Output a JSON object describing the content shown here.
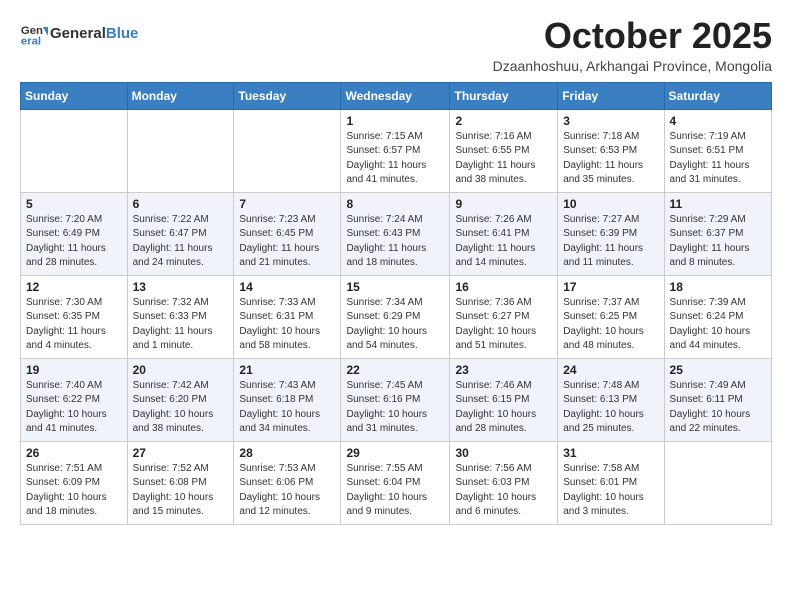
{
  "header": {
    "logo_general": "General",
    "logo_blue": "Blue",
    "title": "October 2025",
    "subtitle": "Dzaanhoshuu, Arkhangai Province, Mongolia"
  },
  "weekdays": [
    "Sunday",
    "Monday",
    "Tuesday",
    "Wednesday",
    "Thursday",
    "Friday",
    "Saturday"
  ],
  "weeks": [
    [
      {
        "day": "",
        "info": ""
      },
      {
        "day": "",
        "info": ""
      },
      {
        "day": "",
        "info": ""
      },
      {
        "day": "1",
        "info": "Sunrise: 7:15 AM\nSunset: 6:57 PM\nDaylight: 11 hours and 41 minutes."
      },
      {
        "day": "2",
        "info": "Sunrise: 7:16 AM\nSunset: 6:55 PM\nDaylight: 11 hours and 38 minutes."
      },
      {
        "day": "3",
        "info": "Sunrise: 7:18 AM\nSunset: 6:53 PM\nDaylight: 11 hours and 35 minutes."
      },
      {
        "day": "4",
        "info": "Sunrise: 7:19 AM\nSunset: 6:51 PM\nDaylight: 11 hours and 31 minutes."
      }
    ],
    [
      {
        "day": "5",
        "info": "Sunrise: 7:20 AM\nSunset: 6:49 PM\nDaylight: 11 hours and 28 minutes."
      },
      {
        "day": "6",
        "info": "Sunrise: 7:22 AM\nSunset: 6:47 PM\nDaylight: 11 hours and 24 minutes."
      },
      {
        "day": "7",
        "info": "Sunrise: 7:23 AM\nSunset: 6:45 PM\nDaylight: 11 hours and 21 minutes."
      },
      {
        "day": "8",
        "info": "Sunrise: 7:24 AM\nSunset: 6:43 PM\nDaylight: 11 hours and 18 minutes."
      },
      {
        "day": "9",
        "info": "Sunrise: 7:26 AM\nSunset: 6:41 PM\nDaylight: 11 hours and 14 minutes."
      },
      {
        "day": "10",
        "info": "Sunrise: 7:27 AM\nSunset: 6:39 PM\nDaylight: 11 hours and 11 minutes."
      },
      {
        "day": "11",
        "info": "Sunrise: 7:29 AM\nSunset: 6:37 PM\nDaylight: 11 hours and 8 minutes."
      }
    ],
    [
      {
        "day": "12",
        "info": "Sunrise: 7:30 AM\nSunset: 6:35 PM\nDaylight: 11 hours and 4 minutes."
      },
      {
        "day": "13",
        "info": "Sunrise: 7:32 AM\nSunset: 6:33 PM\nDaylight: 11 hours and 1 minute."
      },
      {
        "day": "14",
        "info": "Sunrise: 7:33 AM\nSunset: 6:31 PM\nDaylight: 10 hours and 58 minutes."
      },
      {
        "day": "15",
        "info": "Sunrise: 7:34 AM\nSunset: 6:29 PM\nDaylight: 10 hours and 54 minutes."
      },
      {
        "day": "16",
        "info": "Sunrise: 7:36 AM\nSunset: 6:27 PM\nDaylight: 10 hours and 51 minutes."
      },
      {
        "day": "17",
        "info": "Sunrise: 7:37 AM\nSunset: 6:25 PM\nDaylight: 10 hours and 48 minutes."
      },
      {
        "day": "18",
        "info": "Sunrise: 7:39 AM\nSunset: 6:24 PM\nDaylight: 10 hours and 44 minutes."
      }
    ],
    [
      {
        "day": "19",
        "info": "Sunrise: 7:40 AM\nSunset: 6:22 PM\nDaylight: 10 hours and 41 minutes."
      },
      {
        "day": "20",
        "info": "Sunrise: 7:42 AM\nSunset: 6:20 PM\nDaylight: 10 hours and 38 minutes."
      },
      {
        "day": "21",
        "info": "Sunrise: 7:43 AM\nSunset: 6:18 PM\nDaylight: 10 hours and 34 minutes."
      },
      {
        "day": "22",
        "info": "Sunrise: 7:45 AM\nSunset: 6:16 PM\nDaylight: 10 hours and 31 minutes."
      },
      {
        "day": "23",
        "info": "Sunrise: 7:46 AM\nSunset: 6:15 PM\nDaylight: 10 hours and 28 minutes."
      },
      {
        "day": "24",
        "info": "Sunrise: 7:48 AM\nSunset: 6:13 PM\nDaylight: 10 hours and 25 minutes."
      },
      {
        "day": "25",
        "info": "Sunrise: 7:49 AM\nSunset: 6:11 PM\nDaylight: 10 hours and 22 minutes."
      }
    ],
    [
      {
        "day": "26",
        "info": "Sunrise: 7:51 AM\nSunset: 6:09 PM\nDaylight: 10 hours and 18 minutes."
      },
      {
        "day": "27",
        "info": "Sunrise: 7:52 AM\nSunset: 6:08 PM\nDaylight: 10 hours and 15 minutes."
      },
      {
        "day": "28",
        "info": "Sunrise: 7:53 AM\nSunset: 6:06 PM\nDaylight: 10 hours and 12 minutes."
      },
      {
        "day": "29",
        "info": "Sunrise: 7:55 AM\nSunset: 6:04 PM\nDaylight: 10 hours and 9 minutes."
      },
      {
        "day": "30",
        "info": "Sunrise: 7:56 AM\nSunset: 6:03 PM\nDaylight: 10 hours and 6 minutes."
      },
      {
        "day": "31",
        "info": "Sunrise: 7:58 AM\nSunset: 6:01 PM\nDaylight: 10 hours and 3 minutes."
      },
      {
        "day": "",
        "info": ""
      }
    ]
  ]
}
